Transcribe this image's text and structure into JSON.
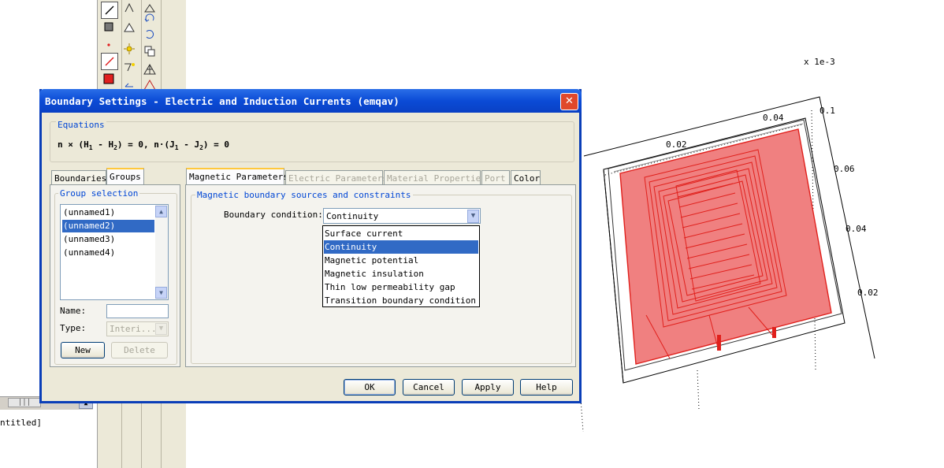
{
  "dialog": {
    "title": "Boundary Settings - Electric and Induction Currents (emqav)",
    "close_glyph": "✕",
    "equations": {
      "label": "Equations",
      "formula_a": "n × (H",
      "sub1": "1",
      "formula_b": " - H",
      "sub2": "2",
      "formula_c": ") = 0,  n·(J",
      "sub3": "1",
      "formula_d": " - J",
      "sub4": "2",
      "formula_e": ") = 0"
    },
    "left_tabs": [
      "Boundaries",
      "Groups"
    ],
    "group_selection": {
      "label": "Group selection",
      "items": [
        "(unnamed1)",
        "(unnamed2)",
        "(unnamed3)",
        "(unnamed4)"
      ],
      "selected": "(unnamed2)",
      "name_label": "Name:",
      "name_value": "",
      "type_label": "Type:",
      "type_value": "Interi...",
      "new_label": "New",
      "delete_label": "Delete"
    },
    "right_tabs": [
      "Magnetic Parameters",
      "Electric Parameters",
      "Material Properties",
      "Port",
      "Color"
    ],
    "active_right_tab": "Magnetic Parameters",
    "magnetic": {
      "label": "Magnetic boundary sources and constraints",
      "bc_label": "Boundary condition:",
      "bc_value": "Continuity",
      "bc_options": [
        "Surface current",
        "Continuity",
        "Magnetic potential",
        "Magnetic insulation",
        "Thin low permeability gap",
        "Transition boundary condition"
      ]
    },
    "buttons": {
      "ok": "OK",
      "cancel": "Cancel",
      "apply": "Apply",
      "help": "Help"
    }
  },
  "background": {
    "untitled_text": "ntitled]",
    "scroll_thumb_glyph": "|||",
    "scroll_btn_glyph": "▲"
  },
  "plot": {
    "scale_label": "x 1e-3",
    "tick_labels": [
      "0.02",
      "0.04",
      "0.06",
      "0.04",
      "0.02",
      "0.1"
    ],
    "highlight_color": "#f08080",
    "edge_color": "#e0201c"
  }
}
